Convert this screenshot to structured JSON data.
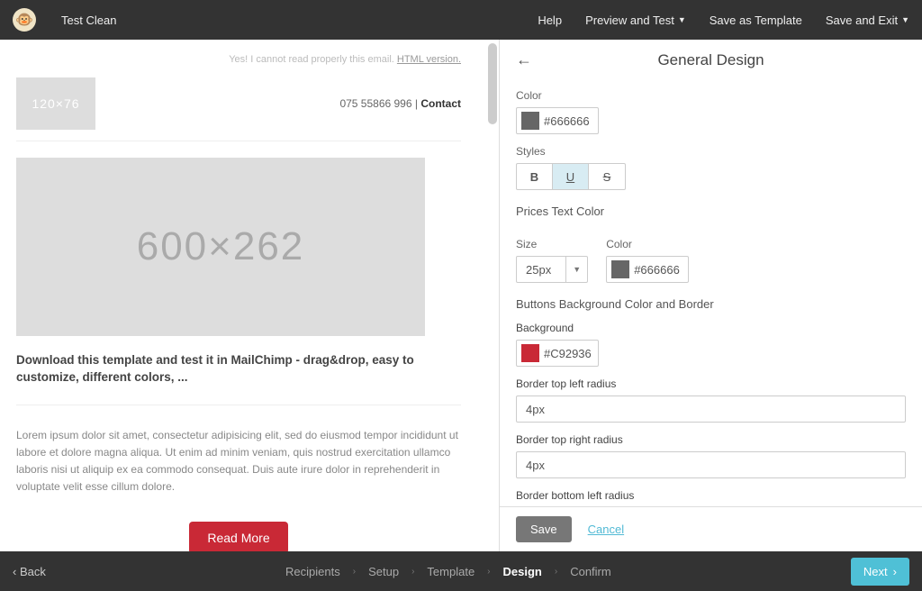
{
  "topbar": {
    "campaign_name": "Test Clean",
    "help": "Help",
    "preview": "Preview and Test",
    "save_template": "Save as Template",
    "save_exit": "Save and Exit"
  },
  "preview": {
    "viewline_pre": "Yes! I cannot read properly this email.",
    "viewline_link": "HTML version.",
    "logo_ph": "120×76",
    "phone": "075 55866 996",
    "sep": "  |  ",
    "contact": "Contact",
    "hero_ph": "600×262",
    "heading": "Download this template and test it in MailChimp - drag&drop, easy to customize, different colors, ...",
    "body": "Lorem ipsum dolor sit amet, consectetur adipisicing elit, sed do eiusmod tempor incididunt ut labore et dolore magna aliqua. Ut enim ad minim veniam, quis nostrud exercitation ullamco laboris nisi ut aliquip ex ea commodo consequat. Duis aute irure dolor in reprehenderit in voluptate velit esse cillum dolore.",
    "cta": "Read More"
  },
  "sidepanel": {
    "title": "General Design",
    "color_lbl": "Color",
    "color_val": "#666666",
    "styles_lbl": "Styles",
    "style_b": "B",
    "style_u": "U",
    "style_s": "S",
    "prices_sec": "Prices Text Color",
    "size_lbl": "Size",
    "size_val": "25px",
    "color2_lbl": "Color",
    "color2_val": "#666666",
    "buttons_sec": "Buttons Background Color and Border",
    "bg_lbl": "Background",
    "bg_val": "#C92936",
    "btlr_lbl": "Border top left radius",
    "btlr_val": "4px",
    "btrr_lbl": "Border top right radius",
    "btrr_val": "4px",
    "bblr_lbl": "Border bottom left radius",
    "save": "Save",
    "cancel": "Cancel"
  },
  "bottombar": {
    "back": "Back",
    "recipients": "Recipients",
    "setup": "Setup",
    "template": "Template",
    "design": "Design",
    "confirm": "Confirm",
    "next": "Next"
  }
}
